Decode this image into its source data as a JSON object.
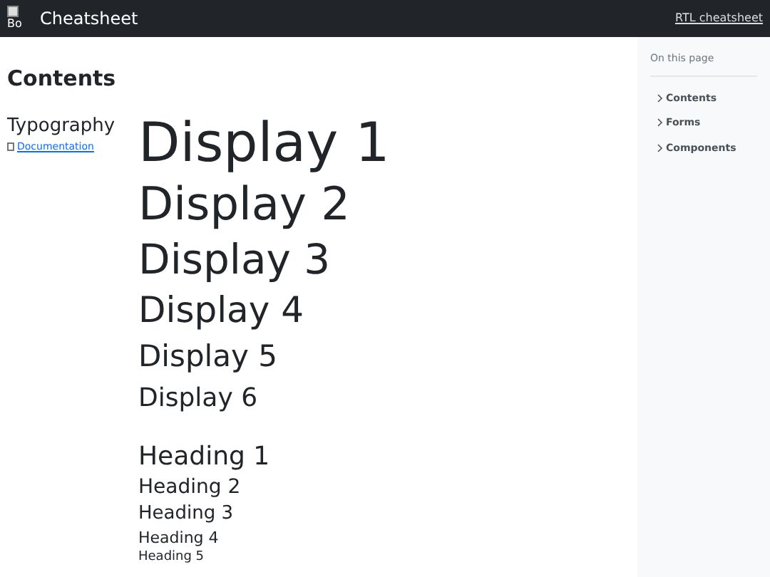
{
  "navbar": {
    "logo_alt": "Bo",
    "title": "Cheatsheet",
    "link": "RTL cheatsheet"
  },
  "contents_title": "Contents",
  "section": {
    "title": "Typography",
    "link": "Documentation"
  },
  "displays": [
    "Display 1",
    "Display 2",
    "Display 3",
    "Display 4",
    "Display 5",
    "Display 6"
  ],
  "headings": [
    "Heading 1",
    "Heading 2",
    "Heading 3",
    "Heading 4",
    "Heading 5"
  ],
  "toc": {
    "title": "On this page",
    "items": [
      "Contents",
      "Forms",
      "Components"
    ]
  }
}
